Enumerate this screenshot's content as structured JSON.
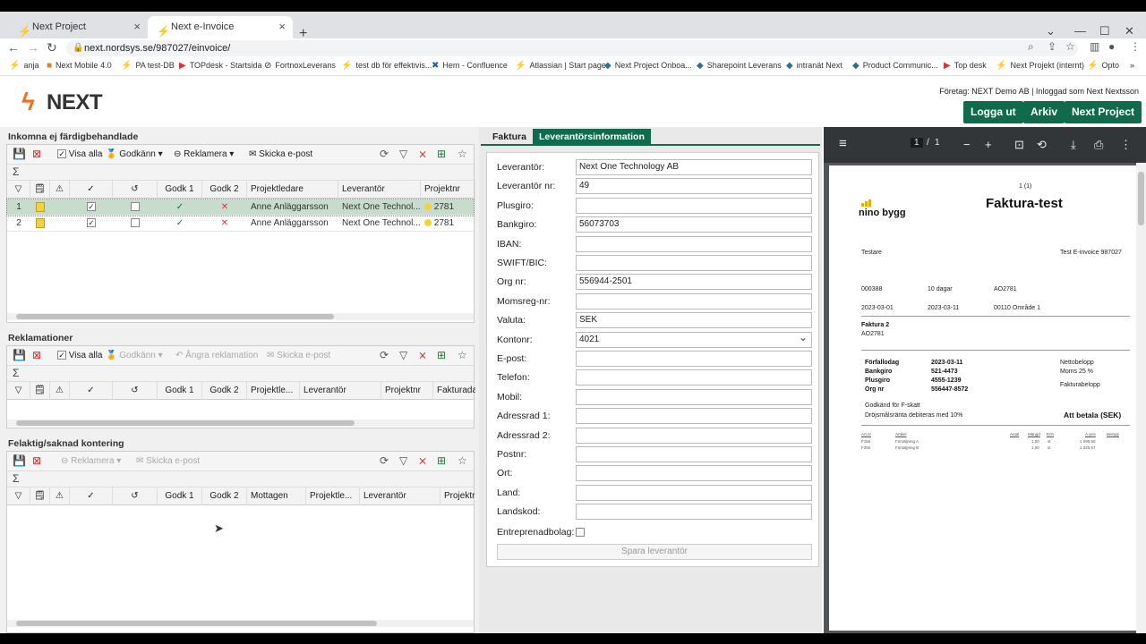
{
  "browser": {
    "tabs": [
      {
        "label": "Next Project",
        "active": false
      },
      {
        "label": "Next e-Invoice",
        "active": true
      }
    ],
    "url": "next.nordsys.se/987027/einvoice/",
    "bookmarks": [
      "anja",
      "Next Mobile 4.0",
      "PA test-DB",
      "TOPdesk - Startsida",
      "FortnoxLeverans",
      "test db för effektivis...",
      "Hem - Confluence",
      "Atlassian | Start page",
      "Next Project Onboa...",
      "Sharepoint Leverans",
      "intranät Next",
      "Product Communic...",
      "Top desk",
      "Next Projekt (internt)",
      "Opto"
    ]
  },
  "header": {
    "logo_text": "NEXT",
    "company_info": "Företag: NEXT Demo AB | Inloggad som Next Nextsson",
    "buttons": [
      "Logga ut",
      "Arkiv",
      "Next Project"
    ]
  },
  "panel1": {
    "title": "Inkomna ej färdigbehandlade",
    "toolbar": {
      "visa_alla": "Visa alla",
      "godkann": "Godkänn",
      "reklamera": "Reklamera",
      "skicka": "Skicka e-post"
    },
    "columns": [
      "Godk 1",
      "Godk 2",
      "Projektledare",
      "Leverantör",
      "Projektnr"
    ],
    "rows": [
      {
        "num": "1",
        "projektledare": "Anne Anläggarsson",
        "leverantor": "Next One Technol...",
        "projektnr": "2781"
      },
      {
        "num": "2",
        "projektledare": "Anne Anläggarsson",
        "leverantor": "Next One Technol...",
        "projektnr": "2781"
      }
    ]
  },
  "panel2": {
    "title": "Reklamationer",
    "toolbar": {
      "visa_alla": "Visa alla",
      "godkann": "Godkänn",
      "angra": "Ångra reklamation",
      "skicka": "Skicka e-post"
    },
    "columns": [
      "Godk 1",
      "Godk 2",
      "Projektle...",
      "Leverantör",
      "Projektnr",
      "Fakturada"
    ]
  },
  "panel3": {
    "title": "Felaktig/saknad kontering",
    "toolbar": {
      "reklamera": "Reklamera",
      "skicka": "Skicka e-post"
    },
    "columns": [
      "Godk 1",
      "Godk 2",
      "Mottagen",
      "Projektle...",
      "Leverantör",
      "Projektr"
    ]
  },
  "form": {
    "tabs": [
      "Faktura",
      "Leverantörsinformation"
    ],
    "fields": [
      {
        "label": "Leverantör:",
        "value": ""
      },
      {
        "label": "Leverantör nr:",
        "value": ""
      },
      {
        "label": "Plusgiro:",
        "value": ""
      },
      {
        "label": "Bankgiro:",
        "value": ""
      },
      {
        "label": "IBAN:",
        "value": ""
      },
      {
        "label": "SWIFT/BIC:",
        "value": ""
      },
      {
        "label": "Org nr:",
        "value": ""
      },
      {
        "label": "Momsreg-nr:",
        "value": ""
      },
      {
        "label": "Valuta:",
        "value": ""
      },
      {
        "label": "Kontonr:",
        "value": ""
      },
      {
        "label": "E-post:",
        "value": ""
      },
      {
        "label": "Telefon:",
        "value": ""
      },
      {
        "label": "Mobil:",
        "value": ""
      },
      {
        "label": "Adressrad 1:",
        "value": ""
      },
      {
        "label": "Adressrad 2:",
        "value": ""
      },
      {
        "label": "Postnr:",
        "value": ""
      },
      {
        "label": "Ort:",
        "value": ""
      },
      {
        "label": "Land:",
        "value": ""
      },
      {
        "label": "Landskod:",
        "value": ""
      }
    ],
    "values": [
      "Next One Technology AB",
      "49",
      "",
      "56073703",
      "",
      "",
      "556944-2501",
      "",
      "SEK",
      "4021",
      "",
      "",
      "",
      "",
      "",
      "",
      "",
      "",
      ""
    ],
    "entreprenad_label": "Entreprenadbolag:",
    "save_label": "Spara leverantör"
  },
  "pdf": {
    "page_current": "1",
    "page_total": "1",
    "page_label": "1 (1)",
    "title": "Faktura-test",
    "logo_text": "nino bygg",
    "customer_ref": "Testare",
    "invoice_address": "Test E-invoice 987027",
    "kundnr": "000388",
    "betalningsvillkor": "10 dagar",
    "ordernr": "AO2781",
    "fakturadatum": "2023-03-01",
    "forfallodag_top": "2023-03-11",
    "area": "00110 Område 1",
    "faktura_nr": "Faktura 2",
    "ao": "AO2781",
    "pay_labels": [
      "Förfallodag",
      "Bankgiro",
      "Plusgiro",
      "Org nr"
    ],
    "pay_values": [
      "2023-03-11",
      "521-4473",
      "4555-1239",
      "556447-8572"
    ],
    "summary_labels": [
      "Nettobelopp",
      "Moms 25 %",
      "Fakturabelopp"
    ],
    "fskatt": "Godkänd för F-skatt",
    "drojsmal": "Dröjsmålsränta debiteras med 10%",
    "att_betala": "Att betala (SEK)",
    "lines": [
      {
        "code": "F150",
        "name": "Försäljning A",
        "qty": "1,00",
        "unit": "st",
        "price": "1 099,50"
      },
      {
        "code": "F250",
        "name": "Försäljning B",
        "qty": "1,00",
        "unit": "st",
        "price": "1 320,67"
      }
    ],
    "line_headers": [
      "Art.nr",
      "Artikel",
      "Antal",
      "Mängd",
      "Enh",
      "Á-pris",
      "Belopp"
    ]
  }
}
